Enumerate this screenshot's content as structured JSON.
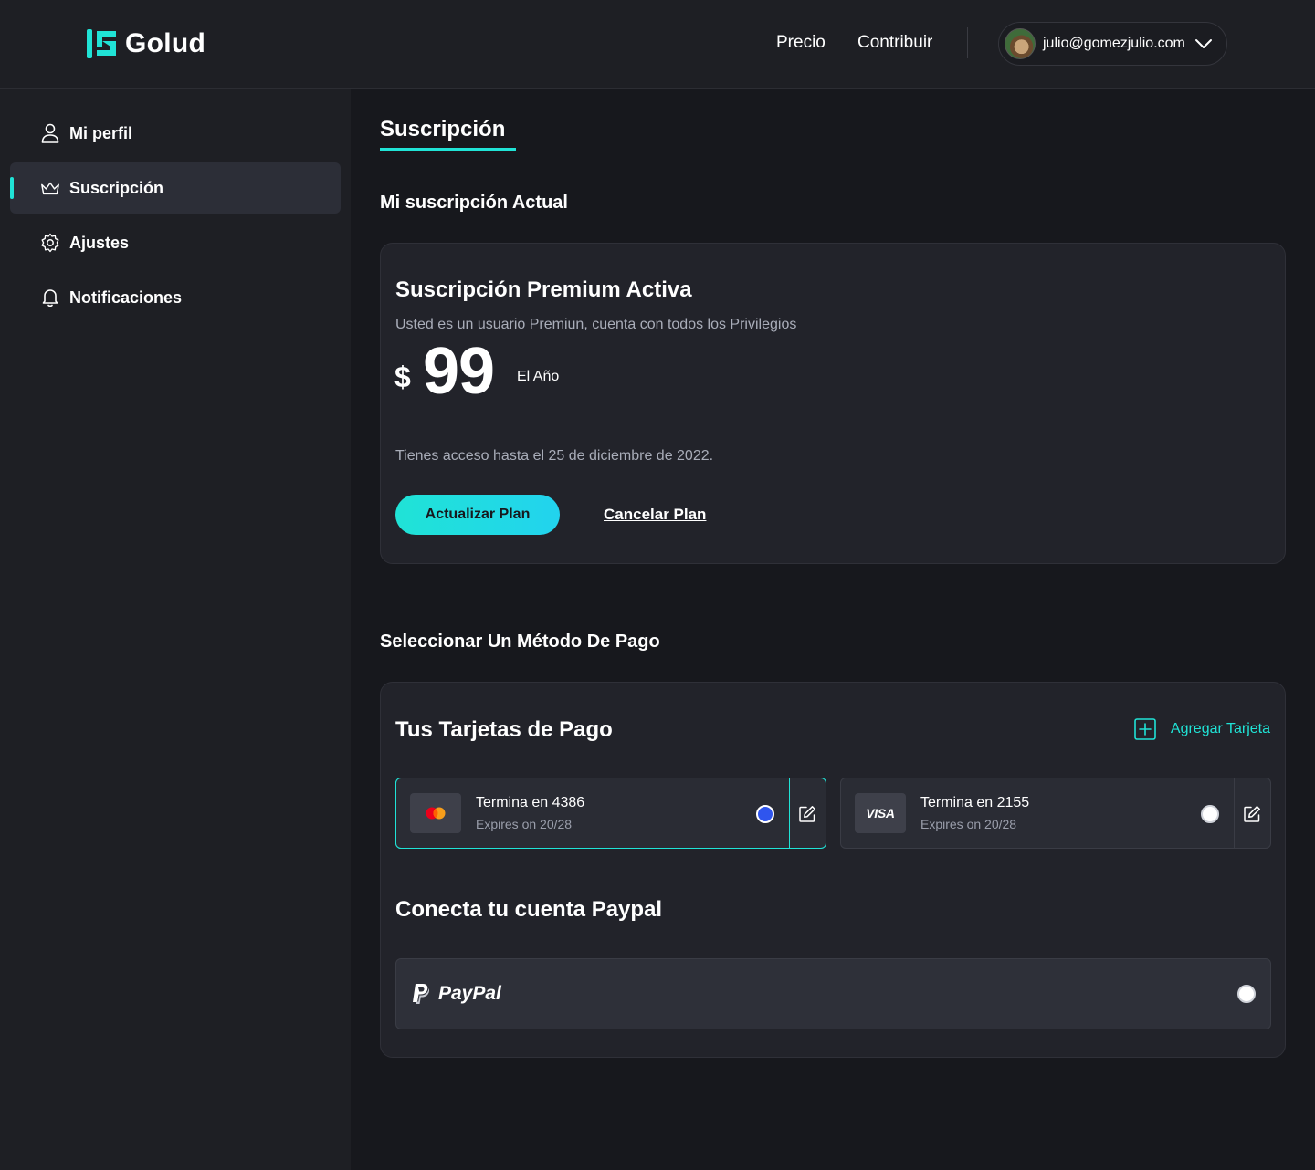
{
  "brand": {
    "name": "Golud",
    "accent": "#20e3d6"
  },
  "header": {
    "nav": [
      {
        "label": "Precio"
      },
      {
        "label": "Contribuir"
      }
    ],
    "user": {
      "email": "julio@gomezjulio.com"
    }
  },
  "sidebar": {
    "items": [
      {
        "label": "Mi perfil",
        "icon": "user-icon"
      },
      {
        "label": "Suscripción",
        "icon": "crown-icon",
        "active": true
      },
      {
        "label": "Ajustes",
        "icon": "gear-icon"
      },
      {
        "label": "Notificaciones",
        "icon": "bell-icon"
      }
    ]
  },
  "main": {
    "title": "Suscripción",
    "current_heading": "Mi suscripción Actual",
    "subscription": {
      "title": "Suscripción Premium Activa",
      "description": "Usted es un usuario Premiun, cuenta con todos los Privilegios",
      "currency": "$",
      "price": "99",
      "period": "El Año",
      "access": "Tienes acceso hasta el 25 de diciembre de 2022.",
      "upgrade_label": "Actualizar Plan",
      "cancel_label": "Cancelar Plan"
    },
    "payment_heading": "Seleccionar Un Método De Pago",
    "payment": {
      "cards_title": "Tus Tarjetas de Pago",
      "add_card_label": "Agregar Tarjeta",
      "cards": [
        {
          "brand": "mastercard",
          "number": "Termina en 4386",
          "expires": "Expires on 20/28",
          "selected": true
        },
        {
          "brand": "VISA",
          "number": "Termina en 2155",
          "expires": "Expires on 20/28",
          "selected": false
        }
      ],
      "paypal_title": "Conecta tu cuenta Paypal",
      "paypal_label": "PayPal",
      "paypal_selected": false
    }
  }
}
